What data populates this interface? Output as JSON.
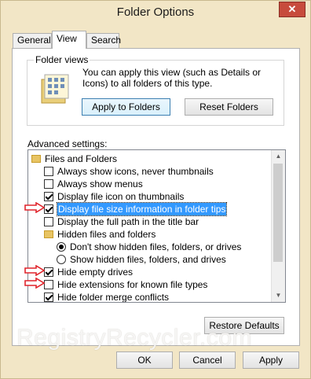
{
  "window": {
    "title": "Folder Options",
    "close_glyph": "✕"
  },
  "tabs": [
    {
      "label": "General",
      "active": false
    },
    {
      "label": "View",
      "active": true
    },
    {
      "label": "Search",
      "active": false
    }
  ],
  "folder_views": {
    "label": "Folder views",
    "description": "You can apply this view (such as Details or Icons) to all folders of this type.",
    "apply_button": "Apply to Folders",
    "reset_button": "Reset Folders",
    "icon": "folder-views-icon"
  },
  "advanced": {
    "label": "Advanced settings:",
    "items": [
      {
        "type": "folder",
        "level": 0,
        "label": "Files and Folders"
      },
      {
        "type": "checkbox",
        "level": 1,
        "checked": false,
        "label": "Always show icons, never thumbnails"
      },
      {
        "type": "checkbox",
        "level": 1,
        "checked": false,
        "label": "Always show menus"
      },
      {
        "type": "checkbox",
        "level": 1,
        "checked": true,
        "label": "Display file icon on thumbnails"
      },
      {
        "type": "checkbox",
        "level": 1,
        "checked": true,
        "label": "Display file size information in folder tips",
        "selected": true,
        "arrow": true
      },
      {
        "type": "checkbox",
        "level": 1,
        "checked": false,
        "label": "Display the full path in the title bar"
      },
      {
        "type": "folder",
        "level": 1,
        "label": "Hidden files and folders"
      },
      {
        "type": "radio",
        "level": 2,
        "checked": true,
        "label": "Don't show hidden files, folders, or drives"
      },
      {
        "type": "radio",
        "level": 2,
        "checked": false,
        "label": "Show hidden files, folders, and drives"
      },
      {
        "type": "checkbox",
        "level": 1,
        "checked": true,
        "label": "Hide empty drives",
        "arrow": true
      },
      {
        "type": "checkbox",
        "level": 1,
        "checked": false,
        "label": "Hide extensions for known file types",
        "arrow": true
      },
      {
        "type": "checkbox",
        "level": 1,
        "checked": true,
        "label": "Hide folder merge conflicts"
      }
    ]
  },
  "restore_button": "Restore Defaults",
  "buttons": {
    "ok": "OK",
    "cancel": "Cancel",
    "apply": "Apply"
  },
  "watermark": "RegistryRecycler.com",
  "colors": {
    "arrow": "#e0242b",
    "selection": "#3399ff",
    "frame": "#f2e6c6"
  }
}
